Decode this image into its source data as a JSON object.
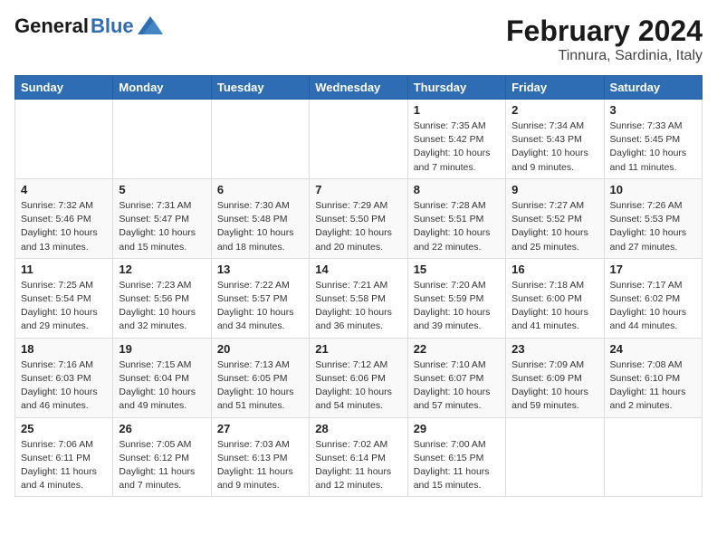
{
  "header": {
    "logo_general": "General",
    "logo_blue": "Blue",
    "month_year": "February 2024",
    "location": "Tinnura, Sardinia, Italy"
  },
  "days_of_week": [
    "Sunday",
    "Monday",
    "Tuesday",
    "Wednesday",
    "Thursday",
    "Friday",
    "Saturday"
  ],
  "weeks": [
    [
      {
        "day": "",
        "info": ""
      },
      {
        "day": "",
        "info": ""
      },
      {
        "day": "",
        "info": ""
      },
      {
        "day": "",
        "info": ""
      },
      {
        "day": "1",
        "info": "Sunrise: 7:35 AM\nSunset: 5:42 PM\nDaylight: 10 hours\nand 7 minutes."
      },
      {
        "day": "2",
        "info": "Sunrise: 7:34 AM\nSunset: 5:43 PM\nDaylight: 10 hours\nand 9 minutes."
      },
      {
        "day": "3",
        "info": "Sunrise: 7:33 AM\nSunset: 5:45 PM\nDaylight: 10 hours\nand 11 minutes."
      }
    ],
    [
      {
        "day": "4",
        "info": "Sunrise: 7:32 AM\nSunset: 5:46 PM\nDaylight: 10 hours\nand 13 minutes."
      },
      {
        "day": "5",
        "info": "Sunrise: 7:31 AM\nSunset: 5:47 PM\nDaylight: 10 hours\nand 15 minutes."
      },
      {
        "day": "6",
        "info": "Sunrise: 7:30 AM\nSunset: 5:48 PM\nDaylight: 10 hours\nand 18 minutes."
      },
      {
        "day": "7",
        "info": "Sunrise: 7:29 AM\nSunset: 5:50 PM\nDaylight: 10 hours\nand 20 minutes."
      },
      {
        "day": "8",
        "info": "Sunrise: 7:28 AM\nSunset: 5:51 PM\nDaylight: 10 hours\nand 22 minutes."
      },
      {
        "day": "9",
        "info": "Sunrise: 7:27 AM\nSunset: 5:52 PM\nDaylight: 10 hours\nand 25 minutes."
      },
      {
        "day": "10",
        "info": "Sunrise: 7:26 AM\nSunset: 5:53 PM\nDaylight: 10 hours\nand 27 minutes."
      }
    ],
    [
      {
        "day": "11",
        "info": "Sunrise: 7:25 AM\nSunset: 5:54 PM\nDaylight: 10 hours\nand 29 minutes."
      },
      {
        "day": "12",
        "info": "Sunrise: 7:23 AM\nSunset: 5:56 PM\nDaylight: 10 hours\nand 32 minutes."
      },
      {
        "day": "13",
        "info": "Sunrise: 7:22 AM\nSunset: 5:57 PM\nDaylight: 10 hours\nand 34 minutes."
      },
      {
        "day": "14",
        "info": "Sunrise: 7:21 AM\nSunset: 5:58 PM\nDaylight: 10 hours\nand 36 minutes."
      },
      {
        "day": "15",
        "info": "Sunrise: 7:20 AM\nSunset: 5:59 PM\nDaylight: 10 hours\nand 39 minutes."
      },
      {
        "day": "16",
        "info": "Sunrise: 7:18 AM\nSunset: 6:00 PM\nDaylight: 10 hours\nand 41 minutes."
      },
      {
        "day": "17",
        "info": "Sunrise: 7:17 AM\nSunset: 6:02 PM\nDaylight: 10 hours\nand 44 minutes."
      }
    ],
    [
      {
        "day": "18",
        "info": "Sunrise: 7:16 AM\nSunset: 6:03 PM\nDaylight: 10 hours\nand 46 minutes."
      },
      {
        "day": "19",
        "info": "Sunrise: 7:15 AM\nSunset: 6:04 PM\nDaylight: 10 hours\nand 49 minutes."
      },
      {
        "day": "20",
        "info": "Sunrise: 7:13 AM\nSunset: 6:05 PM\nDaylight: 10 hours\nand 51 minutes."
      },
      {
        "day": "21",
        "info": "Sunrise: 7:12 AM\nSunset: 6:06 PM\nDaylight: 10 hours\nand 54 minutes."
      },
      {
        "day": "22",
        "info": "Sunrise: 7:10 AM\nSunset: 6:07 PM\nDaylight: 10 hours\nand 57 minutes."
      },
      {
        "day": "23",
        "info": "Sunrise: 7:09 AM\nSunset: 6:09 PM\nDaylight: 10 hours\nand 59 minutes."
      },
      {
        "day": "24",
        "info": "Sunrise: 7:08 AM\nSunset: 6:10 PM\nDaylight: 11 hours\nand 2 minutes."
      }
    ],
    [
      {
        "day": "25",
        "info": "Sunrise: 7:06 AM\nSunset: 6:11 PM\nDaylight: 11 hours\nand 4 minutes."
      },
      {
        "day": "26",
        "info": "Sunrise: 7:05 AM\nSunset: 6:12 PM\nDaylight: 11 hours\nand 7 minutes."
      },
      {
        "day": "27",
        "info": "Sunrise: 7:03 AM\nSunset: 6:13 PM\nDaylight: 11 hours\nand 9 minutes."
      },
      {
        "day": "28",
        "info": "Sunrise: 7:02 AM\nSunset: 6:14 PM\nDaylight: 11 hours\nand 12 minutes."
      },
      {
        "day": "29",
        "info": "Sunrise: 7:00 AM\nSunset: 6:15 PM\nDaylight: 11 hours\nand 15 minutes."
      },
      {
        "day": "",
        "info": ""
      },
      {
        "day": "",
        "info": ""
      }
    ]
  ]
}
